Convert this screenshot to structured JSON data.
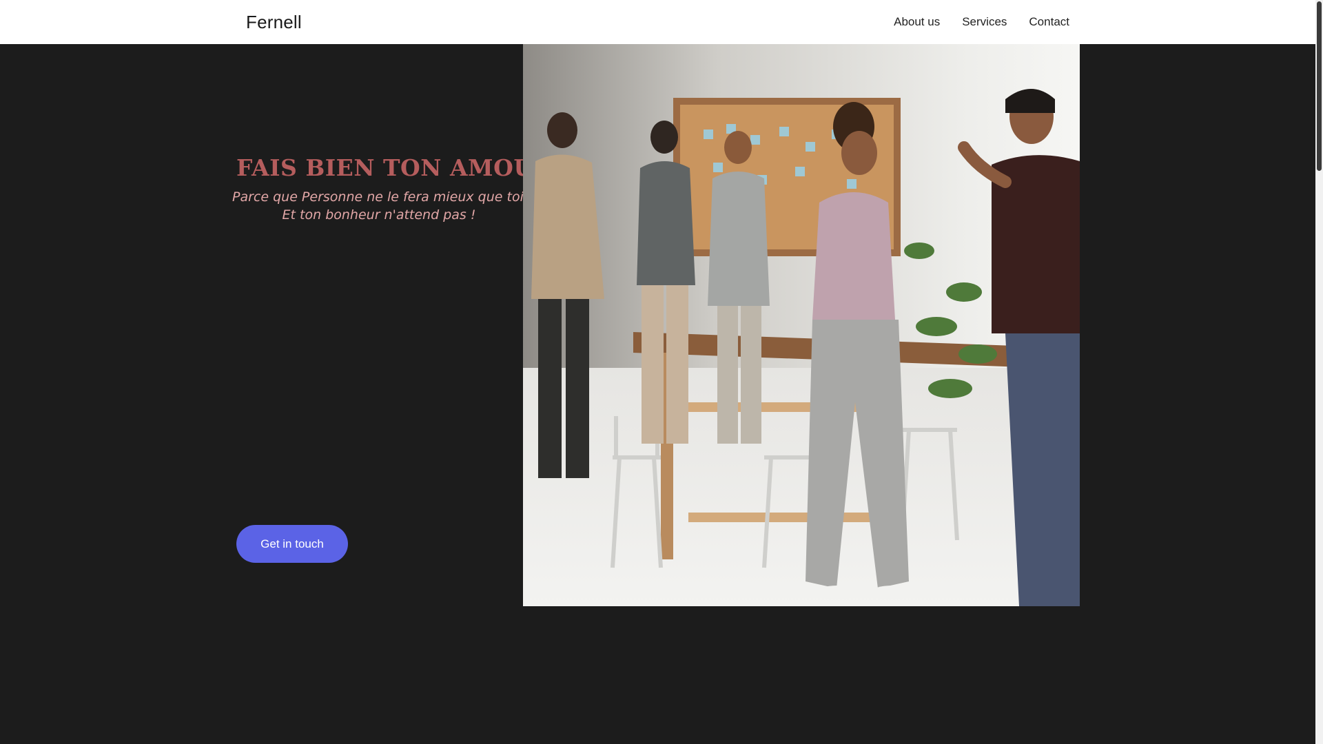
{
  "header": {
    "brand": "Fernell",
    "nav": [
      {
        "label": "About us"
      },
      {
        "label": "Services"
      },
      {
        "label": "Contact"
      }
    ]
  },
  "hero": {
    "title": "FAIS BIEN TON AMOUR !",
    "subtitle_line1": "Parce que Personne ne le fera mieux que toi...",
    "subtitle_line2": "Et ton bonheur n'attend pas !",
    "cta_label": "Get in touch"
  },
  "colors": {
    "background": "#1c1c1c",
    "title": "#b55d5d",
    "subtitle": "#e2a7a7",
    "cta": "#5b63e6"
  }
}
